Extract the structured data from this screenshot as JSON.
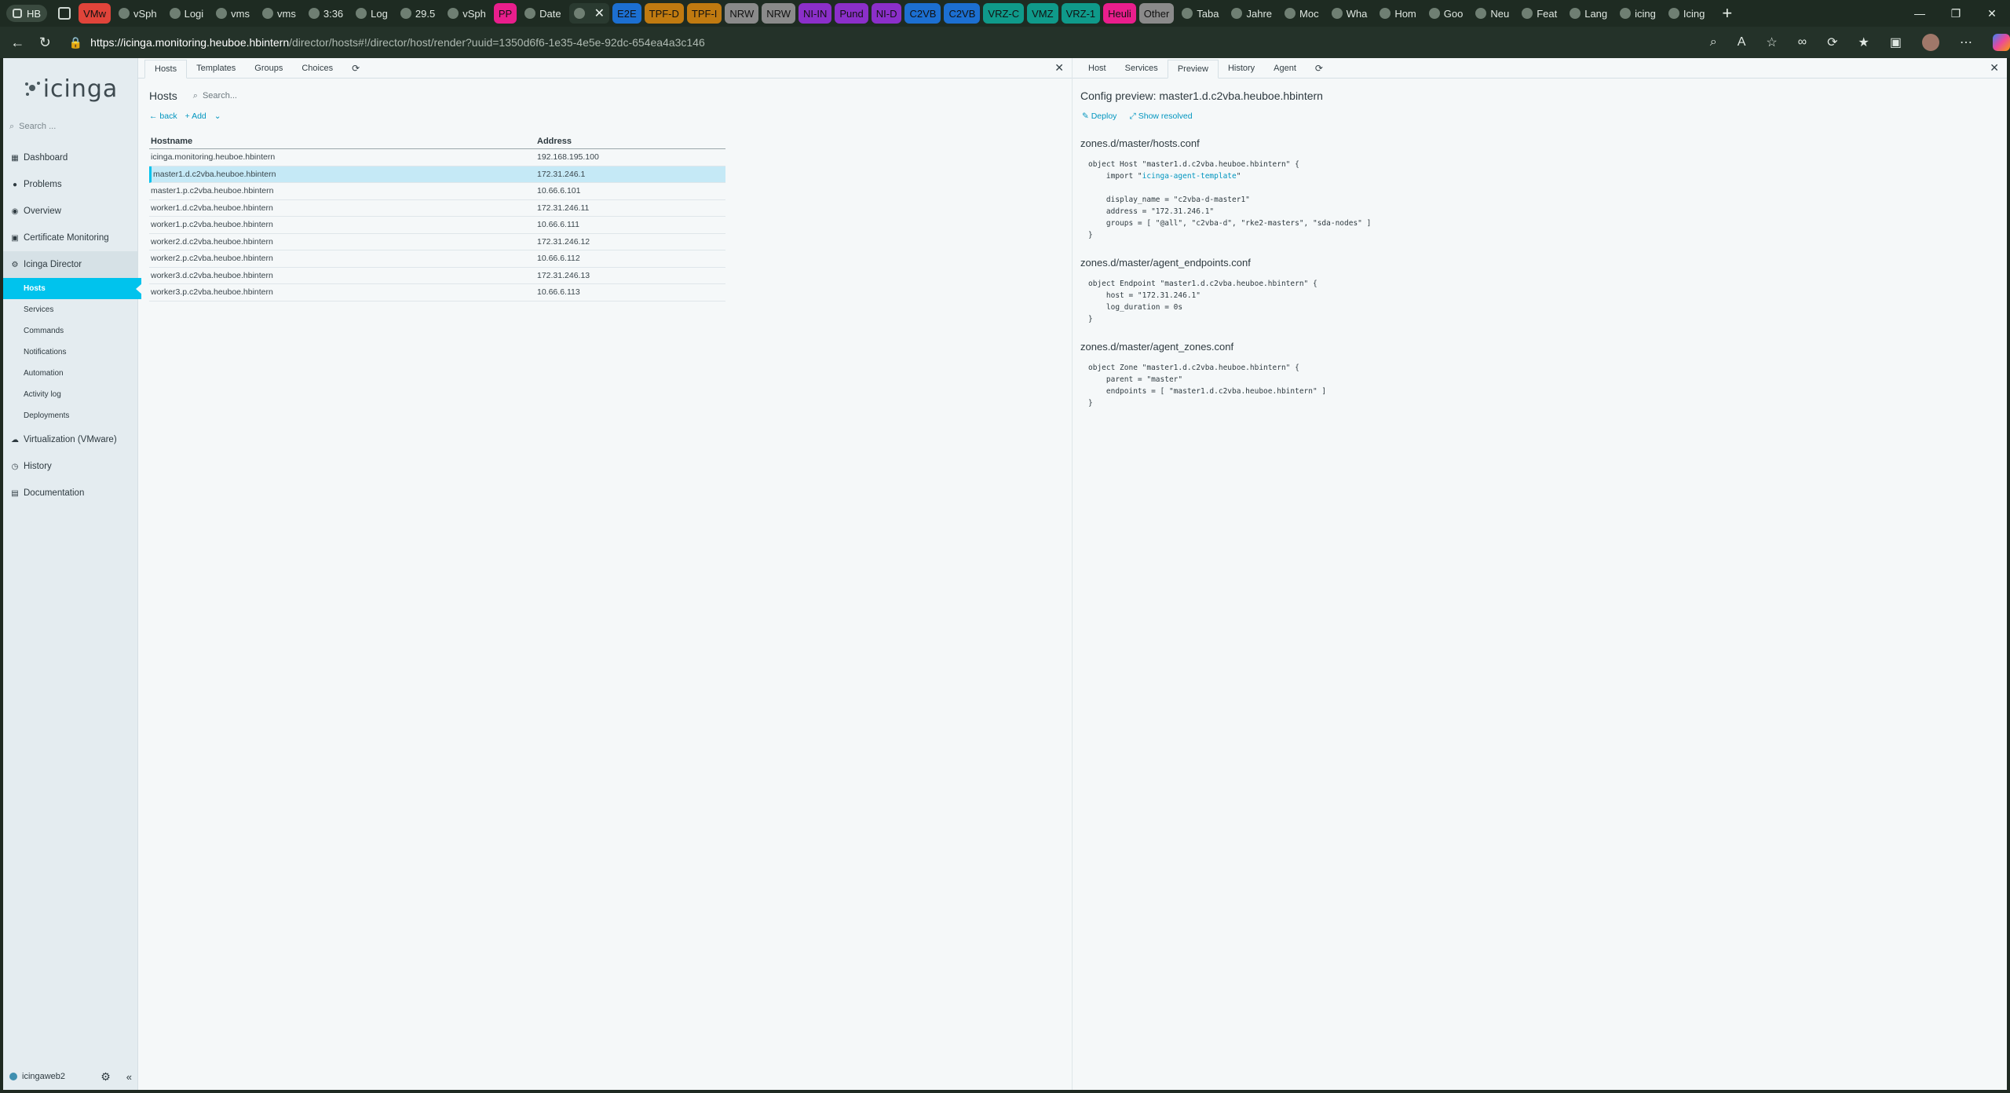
{
  "browser": {
    "profile": "HB",
    "tabs": [
      {
        "label": "VMw",
        "color": "#e0443a"
      },
      {
        "label": "vSph",
        "color": ""
      },
      {
        "label": "Logi",
        "color": ""
      },
      {
        "label": "vms",
        "color": ""
      },
      {
        "label": "vms",
        "color": ""
      },
      {
        "label": "3:36",
        "color": ""
      },
      {
        "label": "Log",
        "color": ""
      },
      {
        "label": "29.5",
        "color": ""
      },
      {
        "label": "vSph",
        "color": ""
      },
      {
        "label": "PP",
        "color": "#e91e8c"
      },
      {
        "label": "Date",
        "color": ""
      },
      {
        "label": "",
        "color": "",
        "active": true
      },
      {
        "label": "E2E",
        "color": "#1c6fd1"
      },
      {
        "label": "TPF-D",
        "color": "#c07a10"
      },
      {
        "label": "TPF-I",
        "color": "#c07a10"
      },
      {
        "label": "NRW",
        "color": "#8a8a8a"
      },
      {
        "label": "NRW",
        "color": "#8a8a8a"
      },
      {
        "label": "NI-IN",
        "color": "#8b2fc9"
      },
      {
        "label": "Pund",
        "color": "#8b2fc9"
      },
      {
        "label": "NI-D",
        "color": "#8b2fc9"
      },
      {
        "label": "C2VB",
        "color": "#1c6fd1"
      },
      {
        "label": "C2VB",
        "color": "#1c6fd1"
      },
      {
        "label": "VRZ-C",
        "color": "#0f9a8a"
      },
      {
        "label": "VMZ",
        "color": "#0f9a8a"
      },
      {
        "label": "VRZ-1",
        "color": "#0f9a8a"
      },
      {
        "label": "Heuli",
        "color": "#e91e8c"
      },
      {
        "label": "Other",
        "color": "#8a8a8a"
      },
      {
        "label": "Taba",
        "color": ""
      },
      {
        "label": "Jahre",
        "color": ""
      },
      {
        "label": "Moc",
        "color": ""
      },
      {
        "label": "Wha",
        "color": ""
      },
      {
        "label": "Hom",
        "color": ""
      },
      {
        "label": "Goo",
        "color": ""
      },
      {
        "label": "Neu",
        "color": ""
      },
      {
        "label": "Feat",
        "color": ""
      },
      {
        "label": "Lang",
        "color": ""
      },
      {
        "label": "icing",
        "color": ""
      },
      {
        "label": "Icing",
        "color": ""
      }
    ],
    "url_host": "https://icinga.monitoring.heuboe.hbintern",
    "url_path": "/director/hosts#!/director/host/render?uuid=1350d6f6-1e35-4e5e-92dc-654ea4a3c146"
  },
  "sidebar": {
    "logo": "icinga",
    "search_placeholder": "Search ...",
    "items": [
      {
        "label": "Dashboard",
        "icon": "dashboard-icon",
        "glyph": "▦"
      },
      {
        "label": "Problems",
        "icon": "problems-icon",
        "glyph": "●"
      },
      {
        "label": "Overview",
        "icon": "overview-icon",
        "glyph": "◉"
      },
      {
        "label": "Certificate Monitoring",
        "icon": "certificate-icon",
        "glyph": "▣"
      },
      {
        "label": "Icinga Director",
        "icon": "director-icon",
        "glyph": "⚙"
      }
    ],
    "subitems": [
      "Hosts",
      "Services",
      "Commands",
      "Notifications",
      "Automation",
      "Activity log",
      "Deployments"
    ],
    "items_after": [
      {
        "label": "Virtualization (VMware)",
        "icon": "vmware-icon",
        "glyph": "☁"
      },
      {
        "label": "History",
        "icon": "history-icon",
        "glyph": "◷"
      },
      {
        "label": "Documentation",
        "icon": "documentation-icon",
        "glyph": "▤"
      }
    ],
    "user": "icingaweb2"
  },
  "left": {
    "tabs": [
      "Hosts",
      "Templates",
      "Groups",
      "Choices"
    ],
    "title": "Hosts",
    "search_placeholder": "Search...",
    "back": "back",
    "add": "Add",
    "columns": [
      "Hostname",
      "Address"
    ],
    "rows": [
      {
        "hostname": "icinga.monitoring.heuboe.hbintern",
        "address": "192.168.195.100"
      },
      {
        "hostname": "master1.d.c2vba.heuboe.hbintern",
        "address": "172.31.246.1",
        "selected": true
      },
      {
        "hostname": "master1.p.c2vba.heuboe.hbintern",
        "address": "10.66.6.101"
      },
      {
        "hostname": "worker1.d.c2vba.heuboe.hbintern",
        "address": "172.31.246.11"
      },
      {
        "hostname": "worker1.p.c2vba.heuboe.hbintern",
        "address": "10.66.6.111"
      },
      {
        "hostname": "worker2.d.c2vba.heuboe.hbintern",
        "address": "172.31.246.12"
      },
      {
        "hostname": "worker2.p.c2vba.heuboe.hbintern",
        "address": "10.66.6.112"
      },
      {
        "hostname": "worker3.d.c2vba.heuboe.hbintern",
        "address": "172.31.246.13"
      },
      {
        "hostname": "worker3.p.c2vba.heuboe.hbintern",
        "address": "10.66.6.113"
      }
    ]
  },
  "right": {
    "tabs": [
      "Host",
      "Services",
      "Preview",
      "History",
      "Agent"
    ],
    "active_tab": "Preview",
    "title": "Config preview: master1.d.c2vba.heuboe.hbintern",
    "deploy": "Deploy",
    "show_resolved": "Show resolved",
    "files": [
      {
        "name": "zones.d/master/hosts.conf",
        "lines": [
          "object Host \"master1.d.c2vba.heuboe.hbintern\" {",
          "    import \"icinga-agent-template\"",
          "",
          "    display_name = \"c2vba-d-master1\"",
          "    address = \"172.31.246.1\"",
          "    groups = [ \"@all\", \"c2vba-d\", \"rke2-masters\", \"sda-nodes\" ]",
          "}"
        ]
      },
      {
        "name": "zones.d/master/agent_endpoints.conf",
        "lines": [
          "object Endpoint \"master1.d.c2vba.heuboe.hbintern\" {",
          "    host = \"172.31.246.1\"",
          "    log_duration = 0s",
          "}"
        ]
      },
      {
        "name": "zones.d/master/agent_zones.conf",
        "lines": [
          "object Zone \"master1.d.c2vba.heuboe.hbintern\" {",
          "    parent = \"master\"",
          "    endpoints = [ \"master1.d.c2vba.heuboe.hbintern\" ]",
          "}"
        ]
      }
    ]
  },
  "colors": {
    "accent": "#00c3ed",
    "link": "#0095bf",
    "sidebar_bg": "#e4ecf0",
    "selected_row": "#c5e9f6"
  }
}
